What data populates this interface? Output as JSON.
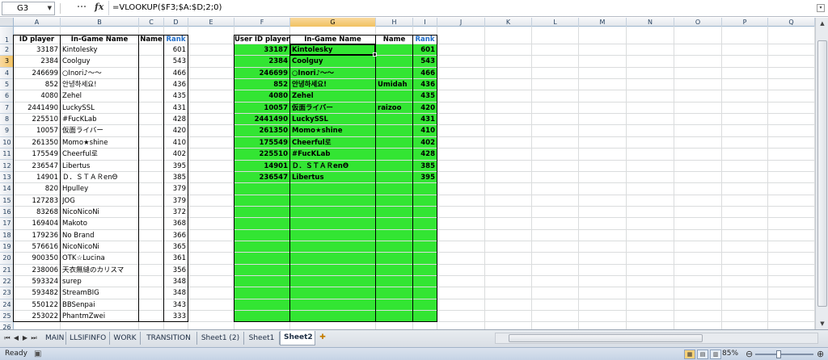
{
  "formula_bar": {
    "name_box": "G3",
    "fx": "fx",
    "formula": "=VLOOKUP($F3;$A:$D;2;0)"
  },
  "columns": [
    "A",
    "B",
    "C",
    "D",
    "E",
    "F",
    "G",
    "H",
    "I",
    "J",
    "K",
    "L",
    "M",
    "N",
    "O",
    "P",
    "Q"
  ],
  "rows": [
    "1",
    "2",
    "3",
    "4",
    "5",
    "6",
    "7",
    "8",
    "9",
    "10",
    "11",
    "12",
    "13",
    "14",
    "15",
    "16",
    "17",
    "18",
    "19",
    "20",
    "21",
    "22",
    "23",
    "24",
    "25",
    "26"
  ],
  "left_table": {
    "headers": {
      "id": "ID player",
      "name": "In-Game Name",
      "c": "Name",
      "rank": "Rank"
    },
    "rows": [
      [
        "33187",
        "Kintolesky",
        "601"
      ],
      [
        "2384",
        "Coolguy",
        "543"
      ],
      [
        "246699",
        "○Inori♪〜〜",
        "466"
      ],
      [
        "852",
        "안녕하세요!",
        "436"
      ],
      [
        "4080",
        "Zehel",
        "435"
      ],
      [
        "2441490",
        "LuckySSL",
        "431"
      ],
      [
        "225510",
        "#FucKLab",
        "428"
      ],
      [
        "10057",
        "仮面ライバー",
        "420"
      ],
      [
        "261350",
        "Momo★shine",
        "410"
      ],
      [
        "175549",
        "Cheerful로",
        "402"
      ],
      [
        "236547",
        "Libertus",
        "395"
      ],
      [
        "14901",
        "Ｄ．ＳＴＡＲenΘ",
        "385"
      ],
      [
        "820",
        "Hpulley",
        "379"
      ],
      [
        "127283",
        "JOG",
        "379"
      ],
      [
        "83268",
        "NicoNicoNi",
        "372"
      ],
      [
        "169404",
        "Makoto",
        "368"
      ],
      [
        "179236",
        "No Brand",
        "366"
      ],
      [
        "576616",
        "NicoNicoNi",
        "365"
      ],
      [
        "900350",
        "OTK☆Lucina",
        "361"
      ],
      [
        "238006",
        "天衣無縫のカリスマ",
        "356"
      ],
      [
        "593324",
        "surep",
        "348"
      ],
      [
        "593482",
        "StreamBIG",
        "348"
      ],
      [
        "550122",
        "BBSenpai",
        "343"
      ],
      [
        "253022",
        "PhantmZwei",
        "333"
      ]
    ]
  },
  "right_table": {
    "headers": {
      "id": "User ID player",
      "name": "In-Game Name",
      "c": "Name",
      "rank": "Rank"
    },
    "rows": [
      [
        "33187",
        "Kintolesky",
        "",
        "601"
      ],
      [
        "2384",
        "Coolguy",
        "",
        "543"
      ],
      [
        "246699",
        "○Inori♪〜〜",
        "",
        "466"
      ],
      [
        "852",
        "안녕하세요!",
        "Umidah",
        "436"
      ],
      [
        "4080",
        "Zehel",
        "",
        "435"
      ],
      [
        "10057",
        "仮面ライバー",
        "raizoo",
        "420"
      ],
      [
        "2441490",
        "LuckySSL",
        "",
        "431"
      ],
      [
        "261350",
        "Momo★shine",
        "",
        "410"
      ],
      [
        "175549",
        "Cheerful로",
        "",
        "402"
      ],
      [
        "225510",
        "#FucKLab",
        "",
        "428"
      ],
      [
        "14901",
        "Ｄ．ＳＴＡＲenΘ",
        "",
        "385"
      ],
      [
        "236547",
        "Libertus",
        "",
        "395"
      ]
    ]
  },
  "tabs": [
    "MAIN",
    "LLSIFINFO",
    "WORK",
    "TRANSITION",
    "Sheet1 (2)",
    "Sheet1",
    "Sheet2"
  ],
  "active_tab": "Sheet2",
  "status": {
    "ready": "Ready",
    "zoom": "85%"
  },
  "colors": {
    "green_fill": "#33e533",
    "rank_header": "#1f6cc7",
    "selection_header": "#f1c15f"
  }
}
